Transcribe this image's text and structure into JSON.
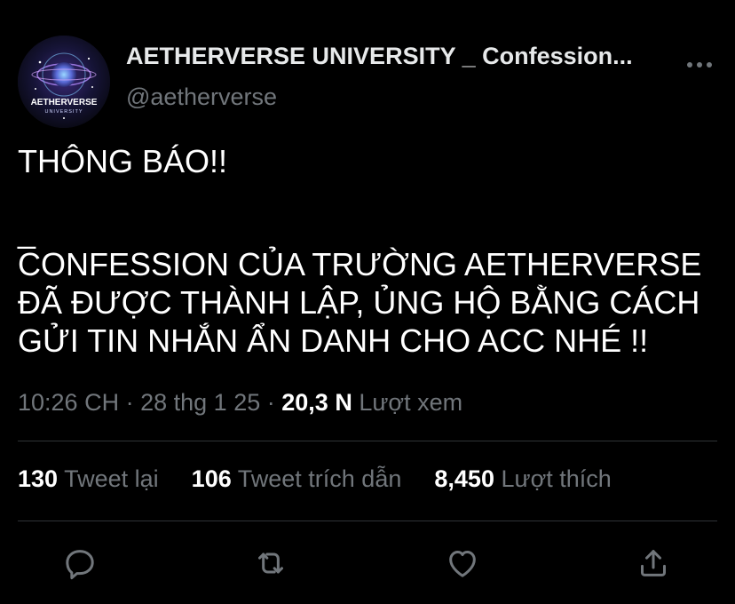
{
  "author": {
    "display_name": "AETHERVERSE UNIVERSITY _ Confession...",
    "handle": "@aetherverse",
    "avatar": {
      "line1": "AETHERVERSE",
      "line2": "UNIVERSITY"
    }
  },
  "tweet": {
    "lines": [
      "THÔNG BÁO!!",
      "_",
      "CONFESSION CỦA TRƯỜNG AETHERVERSE",
      "ĐÃ ĐƯỢC THÀNH LẬP, ỦNG HỘ BẰNG CÁCH",
      "GỬI TIN NHẮN ẨN DANH CHO ACC NHÉ !!"
    ]
  },
  "meta": {
    "time": "10:26 CH",
    "separator": "·",
    "date": "28 thg 1 25",
    "views_count": "20,3 N",
    "views_label": "Lượt xem"
  },
  "stats": {
    "retweets_count": "130",
    "retweets_label": "Tweet lại",
    "quotes_count": "106",
    "quotes_label": "Tweet trích dẫn",
    "likes_count": "8,450",
    "likes_label": "Lượt thích"
  },
  "actions": [
    "reply-icon",
    "retweet-icon",
    "like-icon",
    "share-icon"
  ],
  "colors": {
    "background": "#000000",
    "text": "#e7e9ea",
    "muted": "#71767b",
    "divider": "#2f3336"
  }
}
